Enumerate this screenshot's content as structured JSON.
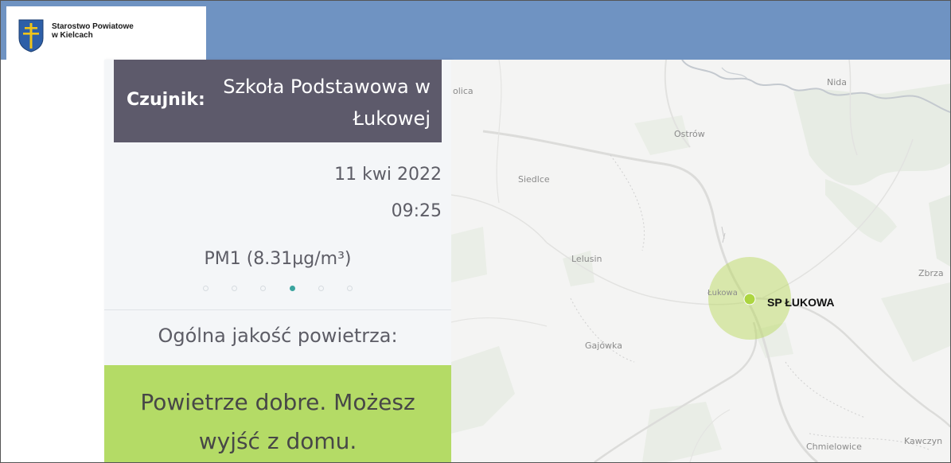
{
  "header": {
    "logo_line1": "Starostwo Powiatowe",
    "logo_line2": "w Kielcach",
    "bar_color": "#6f93c2",
    "crest_icon": "crest-icon"
  },
  "sensor": {
    "label": "Czujnik:",
    "name": "Szkoła Podstawowa w Łukowej"
  },
  "reading": {
    "date": "11 kwi 2022",
    "time": "09:25",
    "pollutant": "PM1 (8.31µg/m³)",
    "carousel_total": 6,
    "carousel_active": 4
  },
  "air_quality": {
    "label": "Ogólna jakość powietrza:",
    "line1": "Powietrze dobre. Możesz",
    "line2": "wyjść z domu.",
    "color": "#b4db66"
  },
  "map": {
    "places": {
      "olica": "olica",
      "nida": "Nida",
      "ostrow": "Ostrów",
      "siedlce": "Siedlce",
      "lelusin": "Lelusin",
      "zbrza": "Zbrza",
      "lukowa": "Łukowa",
      "gajowka": "Gajówka",
      "chmielowice": "Chmielowice",
      "kawczyn": "Kawczyn"
    },
    "marker_label": "SP ŁUKOWA",
    "marker_color": "#a6d22e"
  }
}
